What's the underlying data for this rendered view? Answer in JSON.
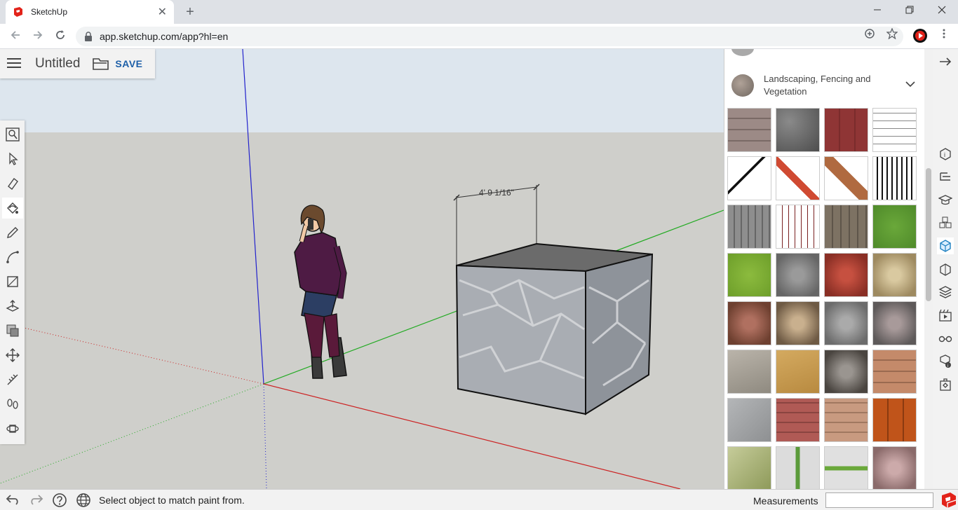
{
  "browser": {
    "tab_title": "SketchUp",
    "url": "app.sketchup.com/app?hl=en",
    "new_tab_symbol": "+",
    "close_symbol": "✕"
  },
  "app": {
    "menu_icon": "hamburger-menu-icon",
    "title": "Untitled",
    "save_label": "SAVE"
  },
  "model": {
    "dimension_label": "4' 9 1/16\""
  },
  "tools": [
    "search-tool-icon",
    "select-tool-icon",
    "eraser-tool-icon",
    "paint-bucket-tool-icon",
    "pencil-tool-icon",
    "arc-tool-icon",
    "rectangle-tool-icon",
    "push-pull-tool-icon",
    "offset-tool-icon",
    "move-tool-icon",
    "tape-measure-tool-icon",
    "walk-tool-icon",
    "orbit-tool-icon"
  ],
  "materials_panel": {
    "category": "Landscaping, Fencing and Vegetation",
    "swatches": [
      "brick-pavers",
      "gray-stone-blocks",
      "red-brick",
      "barbed-wire",
      "chain-link",
      "red-lattice",
      "wood-cross",
      "iron-fence",
      "gray-picket",
      "white-fence",
      "wood-planks",
      "grass-dark",
      "grass-light",
      "gray-gravel",
      "red-gravel",
      "tan-gravel",
      "brown-pebbles",
      "river-rocks",
      "gray-pebbles",
      "mixed-gravel",
      "gray-sand",
      "yellow-sand",
      "speckled-gravel",
      "tan-pavers",
      "gray-flagstone",
      "red-pavers",
      "tan-cobble",
      "orange-tiles",
      "mossy-flagstone",
      "grass-pavers",
      "grass-stones",
      "pink-gravel"
    ]
  },
  "right_rail": [
    "arrow-right-icon",
    "entity-info-icon",
    "outliner-icon",
    "instructor-icon",
    "components-icon",
    "materials-icon",
    "styles-icon",
    "tags-icon",
    "scenes-icon",
    "display-icon",
    "model-info-icon",
    "extensions-icon"
  ],
  "status": {
    "undo_icon": "undo-icon",
    "redo_icon": "redo-icon",
    "help_icon": "help-icon",
    "globe_icon": "globe-icon",
    "message": "Select object to match paint from.",
    "measurements_label": "Measurements",
    "measurements_value": ""
  },
  "colors": {
    "axis_blue": "#2222cc",
    "axis_green": "#22aa22",
    "axis_red": "#cc2222",
    "save_blue": "#1d5fa8",
    "brand_red": "#e2231a"
  }
}
